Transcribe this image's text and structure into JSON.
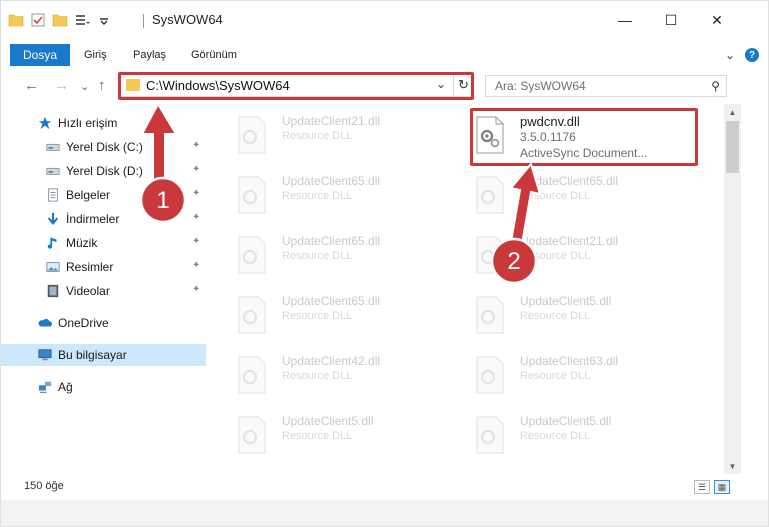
{
  "window": {
    "title": "SysWOW64",
    "minimize": "—",
    "maximize": "☐",
    "close": "✕"
  },
  "ribbon": {
    "tabs": [
      "Dosya",
      "Giriş",
      "Paylaş",
      "Görünüm"
    ],
    "collapse": "⌄",
    "help": "?"
  },
  "address": {
    "back": "←",
    "forward": "→",
    "recent": "⌄",
    "up": "↑",
    "path": "C:\\Windows\\SysWOW64",
    "dropdown": "⌄",
    "refresh": "↻"
  },
  "search": {
    "placeholder": "Ara: SysWOW64",
    "icon": "⚲"
  },
  "nav": {
    "items": [
      {
        "label": "Hızlı erişim",
        "icon": "star-icon",
        "pinned": false
      },
      {
        "label": "Yerel Disk (C:)",
        "icon": "drive-icon",
        "pinned": true
      },
      {
        "label": "Yerel Disk (D:)",
        "icon": "drive-icon",
        "pinned": true
      },
      {
        "label": "Belgeler",
        "icon": "documents-icon",
        "pinned": true
      },
      {
        "label": "İndirmeler",
        "icon": "download-icon",
        "pinned": true
      },
      {
        "label": "Müzik",
        "icon": "music-icon",
        "pinned": true
      },
      {
        "label": "Resimler",
        "icon": "pictures-icon",
        "pinned": true
      },
      {
        "label": "Videolar",
        "icon": "video-icon",
        "pinned": true
      },
      {
        "label": "OneDrive",
        "icon": "cloud-icon",
        "pinned": false
      },
      {
        "label": "Bu bilgisayar",
        "icon": "computer-icon",
        "pinned": false,
        "selected": true
      },
      {
        "label": "Ağ",
        "icon": "network-icon",
        "pinned": false
      }
    ],
    "pin_glyph": "📌"
  },
  "files": {
    "highlighted": {
      "name": "pwdcnv.dll",
      "version": "3.5.0.1176",
      "description": "ActiveSync Document..."
    },
    "left_column": [
      {
        "name": "UpdateClient21.dll",
        "type": "Resource DLL"
      },
      {
        "name": "UpdateClient65.dll",
        "type": "Resource DLL"
      },
      {
        "name": "UpdateClient65.dll",
        "type": "Resource DLL"
      },
      {
        "name": "UpdateClient65.dll",
        "type": "Resource DLL"
      },
      {
        "name": "UpdateClient42.dll",
        "type": "Resource DLL"
      },
      {
        "name": "UpdateClient5.dll",
        "type": "Resource DLL"
      }
    ],
    "right_column": [
      {
        "name": "UpdateClient65.dll",
        "type": "Resource DLL"
      },
      {
        "name": "UpdateClient21.dll",
        "type": "Resource DLL"
      },
      {
        "name": "UpdateClient5.dll",
        "type": "Resource DLL"
      },
      {
        "name": "UpdateClient63.dll",
        "type": "Resource DLL"
      },
      {
        "name": "UpdateClient5.dll",
        "type": "Resource DLL"
      }
    ]
  },
  "status": {
    "count": "150 öğe"
  },
  "callouts": {
    "step1": "1",
    "step2": "2"
  },
  "colors": {
    "accent": "#1979ca",
    "highlight": "#c9383a",
    "selected_bg": "#cce8ff",
    "folder": "#f4ca52"
  }
}
